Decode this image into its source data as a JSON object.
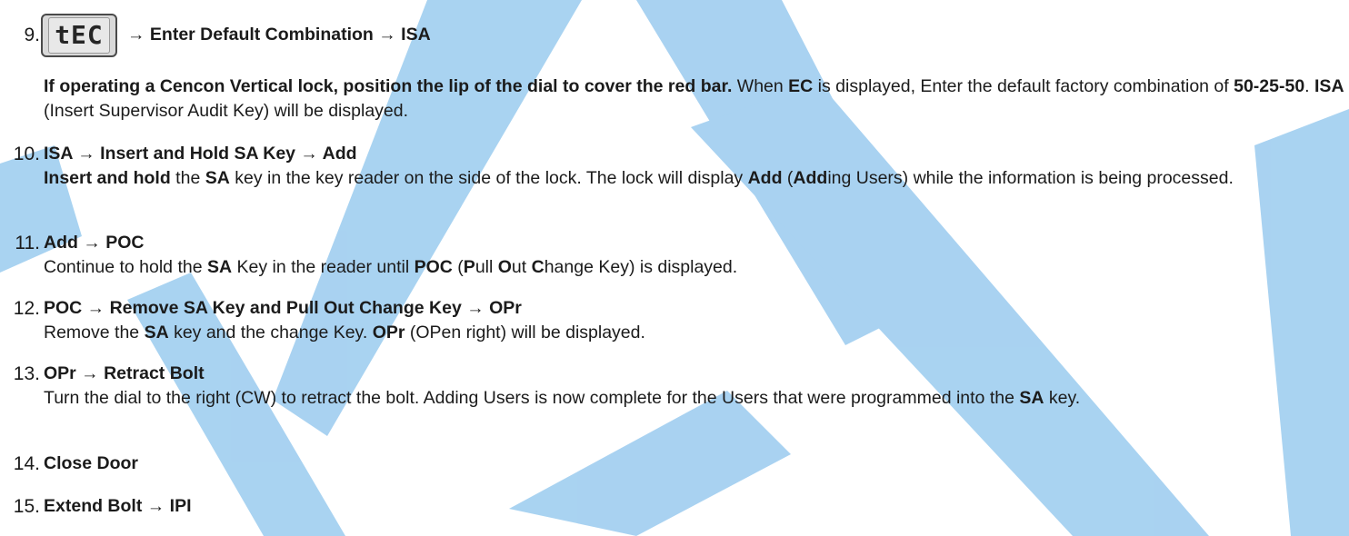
{
  "step9": {
    "num": "9.",
    "lcd_text": "tEC",
    "head": "→ Enter Default Combination → ISA",
    "p1_bold": "If operating a Cencon Vertical lock, position the lip of the dial to cover the red bar.",
    "p1_a": " When ",
    "p1_b1": "EC",
    "p1_c": " is displayed, Enter the default factory combination of ",
    "p1_b2": "50-25-50",
    "p1_d": ". ",
    "p1_b3": "ISA",
    "p1_e": " (Insert Supervisor Audit Key) will be displayed."
  },
  "step10": {
    "num": "10.",
    "head": "ISA → Insert and Hold SA Key → Add",
    "b1": "Insert and hold",
    "t1": " the ",
    "b2": "SA",
    "t2": " key in the key reader on the side of the lock. The lock will display ",
    "b3": "Add",
    "t3": " (",
    "b4": "Add",
    "t4": "ing Users) while the information is being processed."
  },
  "step11": {
    "num": "11.",
    "head": "Add → POC",
    "t1": "Continue to hold the ",
    "b1": "SA",
    "t2": " Key in the reader until ",
    "b2": "POC",
    "t3": " (",
    "b3": "P",
    "t4": "ull ",
    "b4": "O",
    "t5": "ut ",
    "b5": "C",
    "t6": "hange Key) is displayed."
  },
  "step12": {
    "num": "12.",
    "head": "POC → Remove SA Key and Pull Out Change Key → OPr",
    "t1": "Remove the ",
    "b1": "SA",
    "t2": " key and the change Key. ",
    "b2": "OPr",
    "t3": " (OPen right) will be displayed."
  },
  "step13": {
    "num": "13.",
    "head": "OPr → Retract Bolt",
    "t1": "Turn the dial to the right (CW) to retract the bolt. Adding Users is now complete for the Users that were programmed into the ",
    "b1": "SA",
    "t2": " key."
  },
  "step14": {
    "num": "14.",
    "head": "Close Door"
  },
  "step15": {
    "num": "15.",
    "head": "Extend Bolt → IPI"
  },
  "colors": {
    "watermark": "#63aee6",
    "text": "#1b1b1b"
  }
}
